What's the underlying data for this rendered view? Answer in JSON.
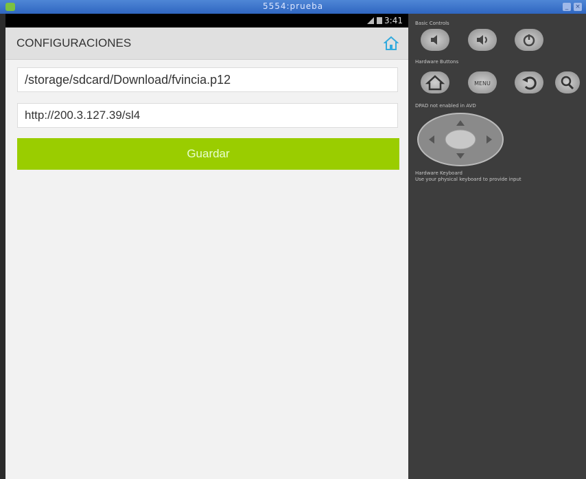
{
  "window": {
    "title": "5554:prueba"
  },
  "statusbar": {
    "time": "3:41"
  },
  "actionbar": {
    "title": "CONFIGURACIONES",
    "home_icon": "home-icon"
  },
  "form": {
    "path_value": "/storage/sdcard/Download/fvincia.p12",
    "url_value": "http://200.3.127.39/sl4",
    "save_label": "Guardar",
    "accent_color": "#9acd00"
  },
  "emulator_panel": {
    "basic_controls_label": "Basic Controls",
    "hardware_buttons_label": "Hardware Buttons",
    "dpad_label": "DPAD not enabled in AVD",
    "keyboard_label": "Hardware Keyboard",
    "keyboard_hint": "Use your physical keyboard to provide input",
    "menu_label": "MENU"
  }
}
